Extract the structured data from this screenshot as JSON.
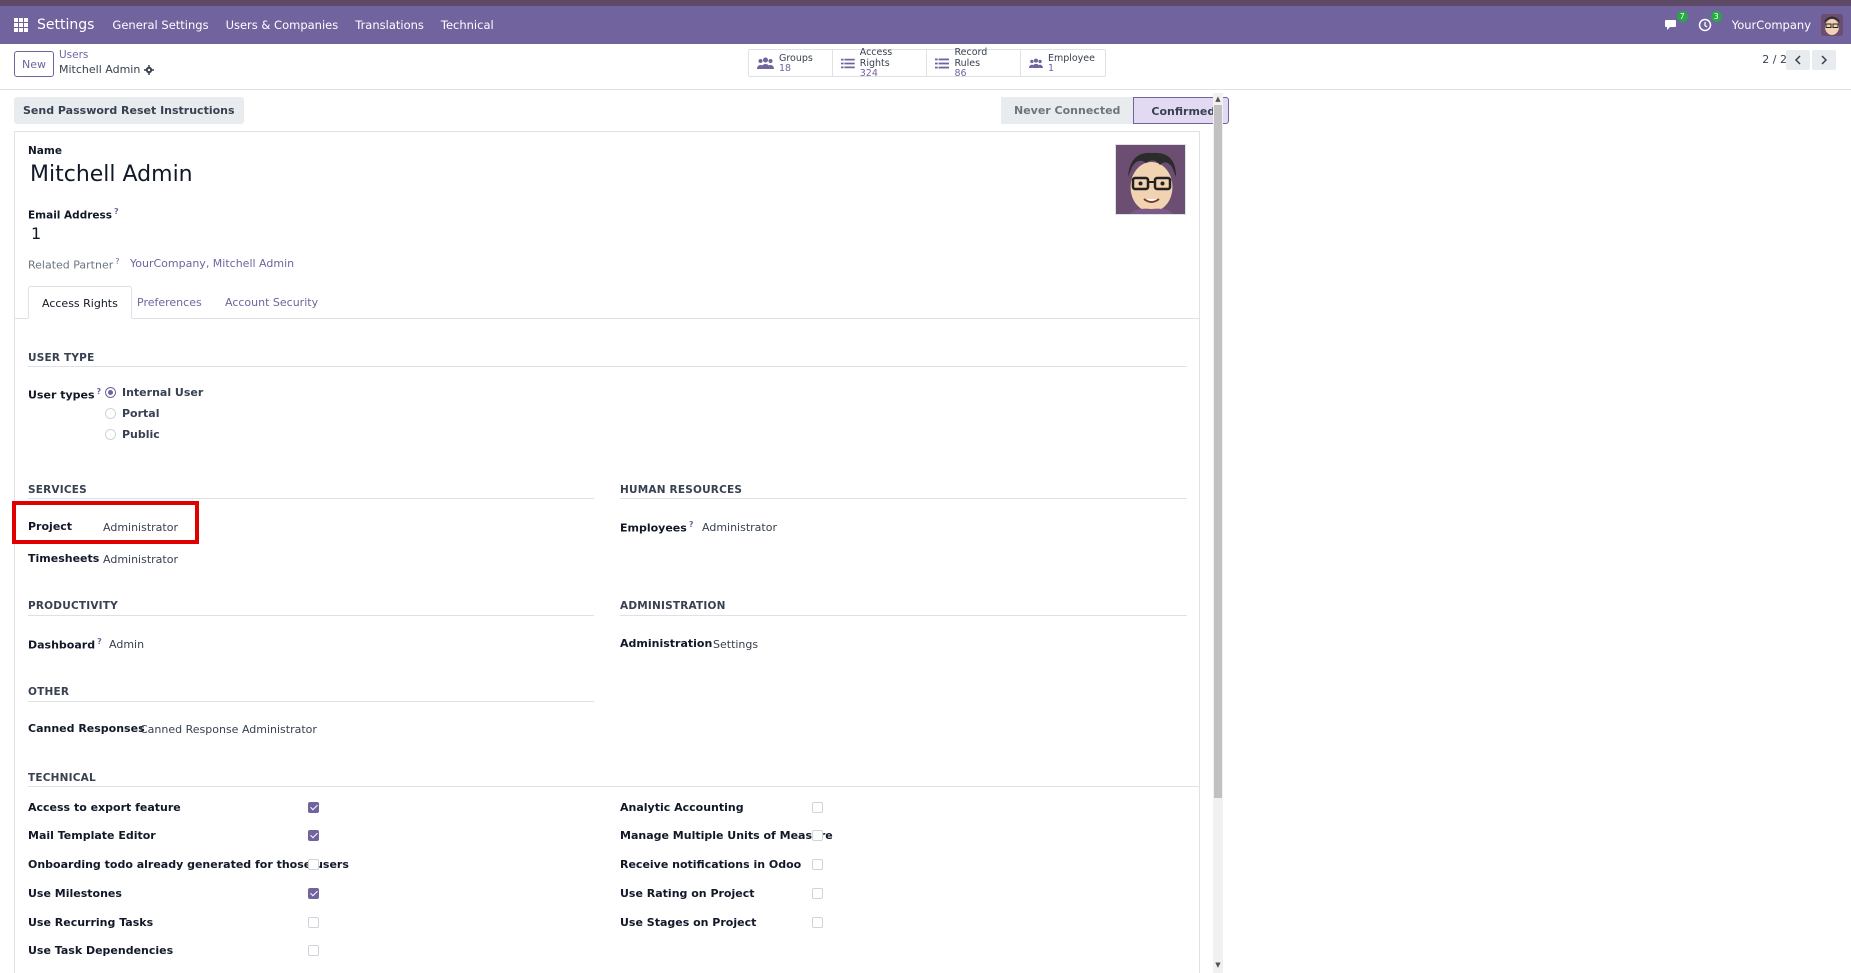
{
  "navbar": {
    "brand": "Settings",
    "menu": [
      "General Settings",
      "Users & Companies",
      "Translations",
      "Technical"
    ],
    "messages_badge": "7",
    "activity_badge": "3",
    "company": "YourCompany"
  },
  "control": {
    "new_label": "New",
    "breadcrumb_parent": "Users",
    "breadcrumb_current": "Mitchell Admin",
    "smart_buttons": [
      {
        "label": "Groups",
        "value": "18",
        "icon": "users-icon"
      },
      {
        "label": "Access Rights",
        "value": "324",
        "icon": "list-icon"
      },
      {
        "label": "Record Rules",
        "value": "86",
        "icon": "list-icon"
      },
      {
        "label": "Employee",
        "value": "1",
        "icon": "users-icon"
      }
    ],
    "pager": "2 / 2"
  },
  "actions": {
    "reset_label": "Send Password Reset Instructions",
    "status": [
      "Never Connected",
      "Confirmed"
    ],
    "status_active": "Confirmed"
  },
  "form": {
    "name_label": "Name",
    "name_value": "Mitchell Admin",
    "email_label": "Email Address",
    "email_value": "1",
    "partner_label": "Related Partner",
    "partner_value": "YourCompany, Mitchell Admin",
    "help_mark": "?",
    "tabs": [
      "Access Rights",
      "Preferences",
      "Account Security"
    ]
  },
  "access": {
    "user_type_title": "USER TYPE",
    "user_types_label": "User types",
    "user_types": [
      "Internal User",
      "Portal",
      "Public"
    ],
    "user_type_selected": "Internal User",
    "services_title": "SERVICES",
    "services": [
      {
        "label": "Project",
        "value": "Administrator"
      },
      {
        "label": "Timesheets",
        "value": "Administrator"
      }
    ],
    "hr_title": "HUMAN RESOURCES",
    "hr": [
      {
        "label": "Employees",
        "value": "Administrator"
      }
    ],
    "productivity_title": "PRODUCTIVITY",
    "productivity": [
      {
        "label": "Dashboard",
        "value": "Admin"
      }
    ],
    "administration_title": "ADMINISTRATION",
    "administration": [
      {
        "label": "Administration",
        "value": "Settings"
      }
    ],
    "other_title": "OTHER",
    "other": [
      {
        "label": "Canned Responses",
        "value": "Canned Response Administrator"
      }
    ],
    "technical_title": "TECHNICAL",
    "technical_left": [
      {
        "label": "Access to export feature",
        "checked": true
      },
      {
        "label": "Mail Template Editor",
        "checked": true
      },
      {
        "label": "Onboarding todo already generated for those users",
        "checked": false
      },
      {
        "label": "Use Milestones",
        "checked": true
      },
      {
        "label": "Use Recurring Tasks",
        "checked": false
      },
      {
        "label": "Use Task Dependencies",
        "checked": false
      }
    ],
    "technical_right": [
      {
        "label": "Analytic Accounting",
        "checked": false
      },
      {
        "label": "Manage Multiple Units of Measure",
        "checked": false
      },
      {
        "label": "Receive notifications in Odoo",
        "checked": false
      },
      {
        "label": "Use Rating on Project",
        "checked": false
      },
      {
        "label": "Use Stages on Project",
        "checked": false
      }
    ]
  },
  "colors": {
    "brand": "#71639e",
    "highlight": "#e00000"
  }
}
